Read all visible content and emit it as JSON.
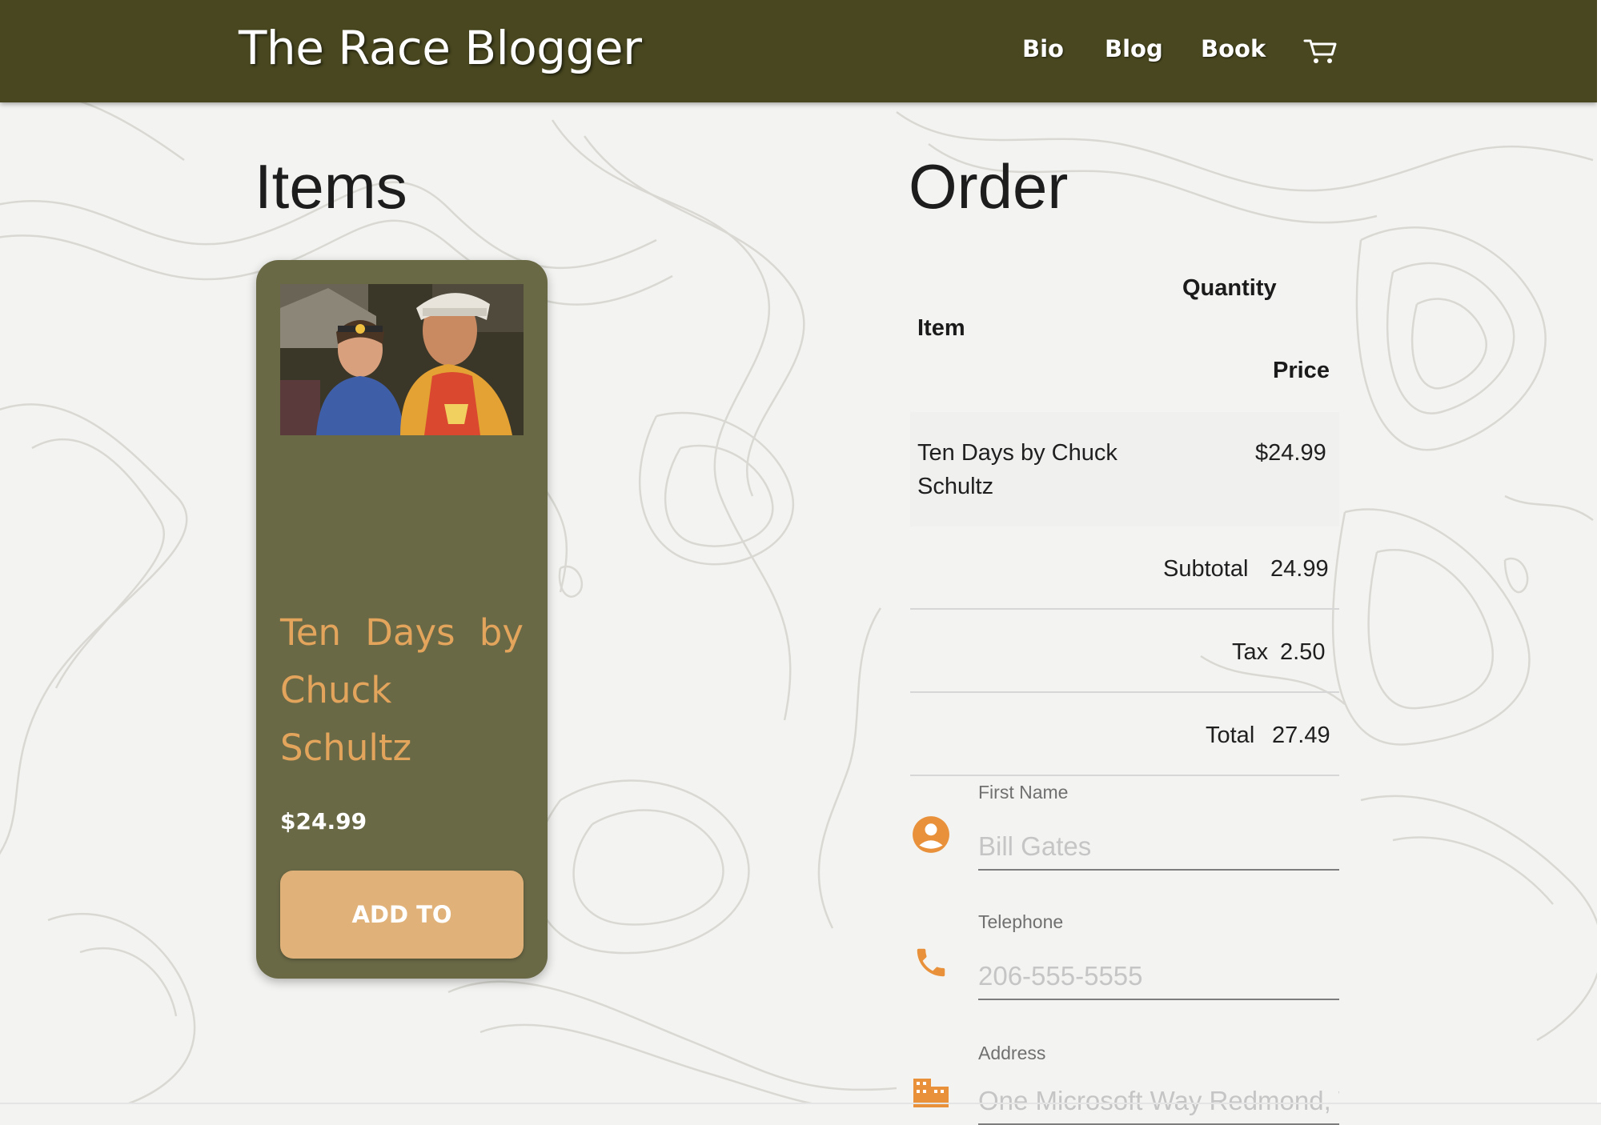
{
  "header": {
    "brand": "The Race Blogger",
    "nav": [
      {
        "label": "Bio"
      },
      {
        "label": "Blog"
      },
      {
        "label": "Book"
      }
    ],
    "cart_icon": "shopping-cart-icon"
  },
  "items_section": {
    "title": "Items",
    "product": {
      "title": "Ten Days by Chuck Schultz",
      "price": "$24.99",
      "button_label": "ADD TO"
    }
  },
  "order_section": {
    "title": "Order",
    "columns": {
      "quantity": "Quantity",
      "item": "Item",
      "price": "Price"
    },
    "rows": [
      {
        "item": "Ten Days by Chuck Schultz",
        "price": "$24.99"
      }
    ],
    "summary": {
      "subtotal_label": "Subtotal",
      "subtotal_value": "24.99",
      "tax_label": "Tax",
      "tax_value": "2.50",
      "total_label": "Total",
      "total_value": "27.49"
    },
    "form": {
      "first_name": {
        "label": "First Name",
        "placeholder": "Bill Gates",
        "icon": "account-circle-icon"
      },
      "telephone": {
        "label": "Telephone",
        "placeholder": "206-555-5555",
        "icon": "phone-icon"
      },
      "address": {
        "label": "Address",
        "placeholder": "One Microsoft Way Redmond, WA",
        "icon": "business-icon"
      }
    }
  },
  "colors": {
    "navbar": "#48471f",
    "card": "#6a6946",
    "card_title": "#e3a45c",
    "button": "#e0b27a",
    "icon_accent": "#e8913a"
  }
}
